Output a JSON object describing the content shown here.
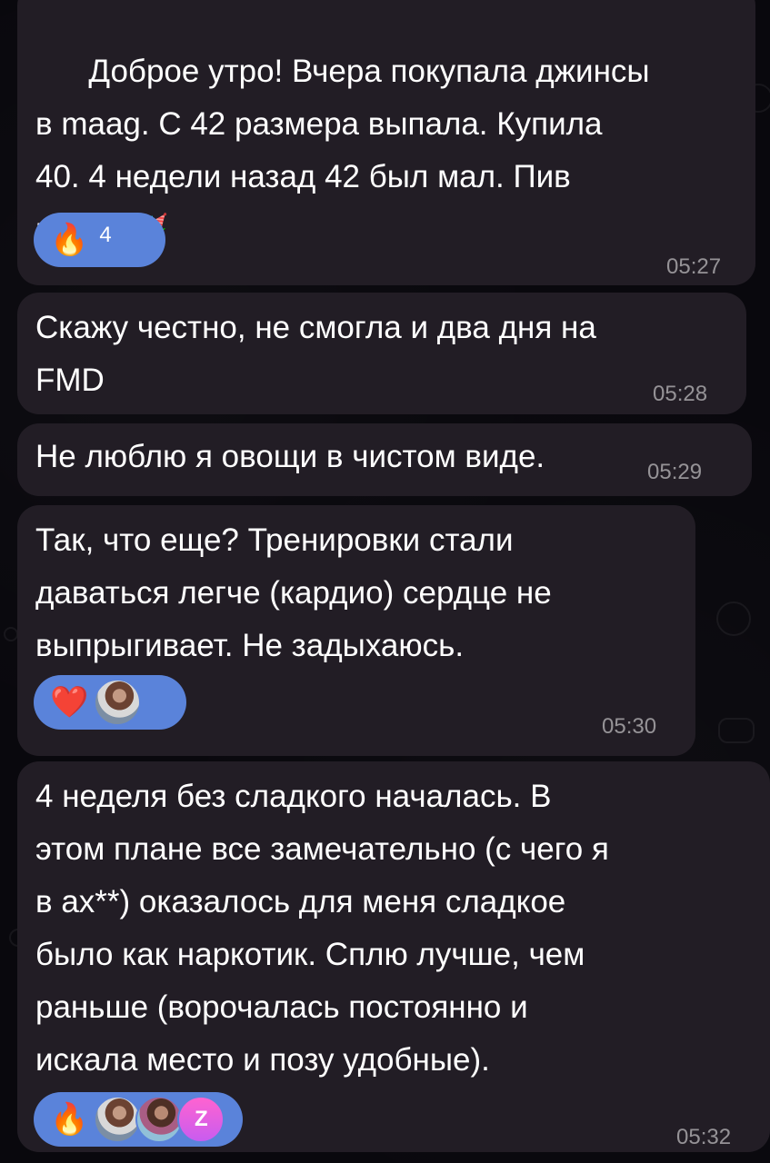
{
  "messages": [
    {
      "text": "Доброе утро! Вчера покупала джинсы\nв maag. С 42 размера выпала. Купила\n40. 4 недели назад 42 был мал. Пив\nпав",
      "emoji_after": [
        "👉",
        "🥳"
      ],
      "reaction": {
        "emoji": "🔥",
        "count": "4"
      },
      "time": "05:27"
    },
    {
      "text": "Скажу честно, не смогла и два дня на\nFMD",
      "time": "05:28"
    },
    {
      "text": "Не люблю я овощи в чистом виде.",
      "time": "05:29"
    },
    {
      "text": "Так, что еще? Тренировки стали\nдаваться легче (кардио) сердце не\nвыпрыгивает. Не задыхаюсь.",
      "reaction": {
        "emoji": "❤️",
        "avatars": [
          "user-avatar-1"
        ]
      },
      "time": "05:30"
    },
    {
      "text": "4 неделя без сладкого началась. В\nэтом плане все замечательно (с чего я\nв ах**) оказалось для меня сладкое\nбыло как наркотик. Сплю лучше, чем\nраньше (ворочалась постоянно и\nискала место и позу удобные).",
      "reaction": {
        "emoji": "🔥",
        "avatars": [
          "user-avatar-1",
          "user-avatar-2",
          "user-avatar-3"
        ],
        "avatar_letter": "Z"
      },
      "time": "05:32"
    }
  ],
  "colors": {
    "background": "#09080d",
    "message_bubble": "#221d25",
    "reaction_pill": "#5a83da",
    "time_text": "#8f8a92"
  }
}
